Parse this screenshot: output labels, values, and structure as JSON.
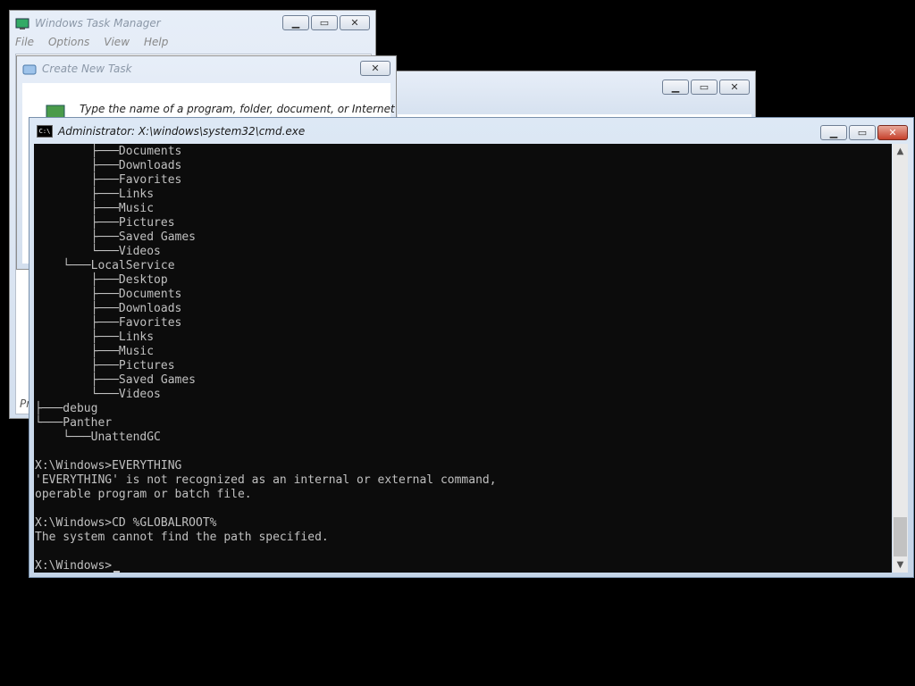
{
  "task_manager": {
    "title": "Windows Task Manager",
    "menu": [
      "File",
      "Options",
      "View",
      "Help"
    ]
  },
  "create_task": {
    "title": "Create New Task",
    "prompt": "Type the name of a program, folder, document, or Internet",
    "side_label": "Pr"
  },
  "cmd": {
    "title": "Administrator: X:\\windows\\system32\\cmd.exe",
    "icon_text": "C:\\",
    "lines": [
      "        ├───Documents",
      "        ├───Downloads",
      "        ├───Favorites",
      "        ├───Links",
      "        ├───Music",
      "        ├───Pictures",
      "        ├───Saved Games",
      "        └───Videos",
      "    └───LocalService",
      "        ├───Desktop",
      "        ├───Documents",
      "        ├───Downloads",
      "        ├───Favorites",
      "        ├───Links",
      "        ├───Music",
      "        ├───Pictures",
      "        ├───Saved Games",
      "        └───Videos",
      "├───debug",
      "└───Panther",
      "    └───UnattendGC",
      "",
      "X:\\Windows>EVERYTHING",
      "'EVERYTHING' is not recognized as an internal or external command,",
      "operable program or batch file.",
      "",
      "X:\\Windows>CD %GLOBALROOT%",
      "The system cannot find the path specified.",
      "",
      "X:\\Windows>"
    ]
  },
  "colors": {
    "console_bg": "#0c0c0c",
    "console_text": "#c0c0c0",
    "close_red": "#c6402a"
  }
}
